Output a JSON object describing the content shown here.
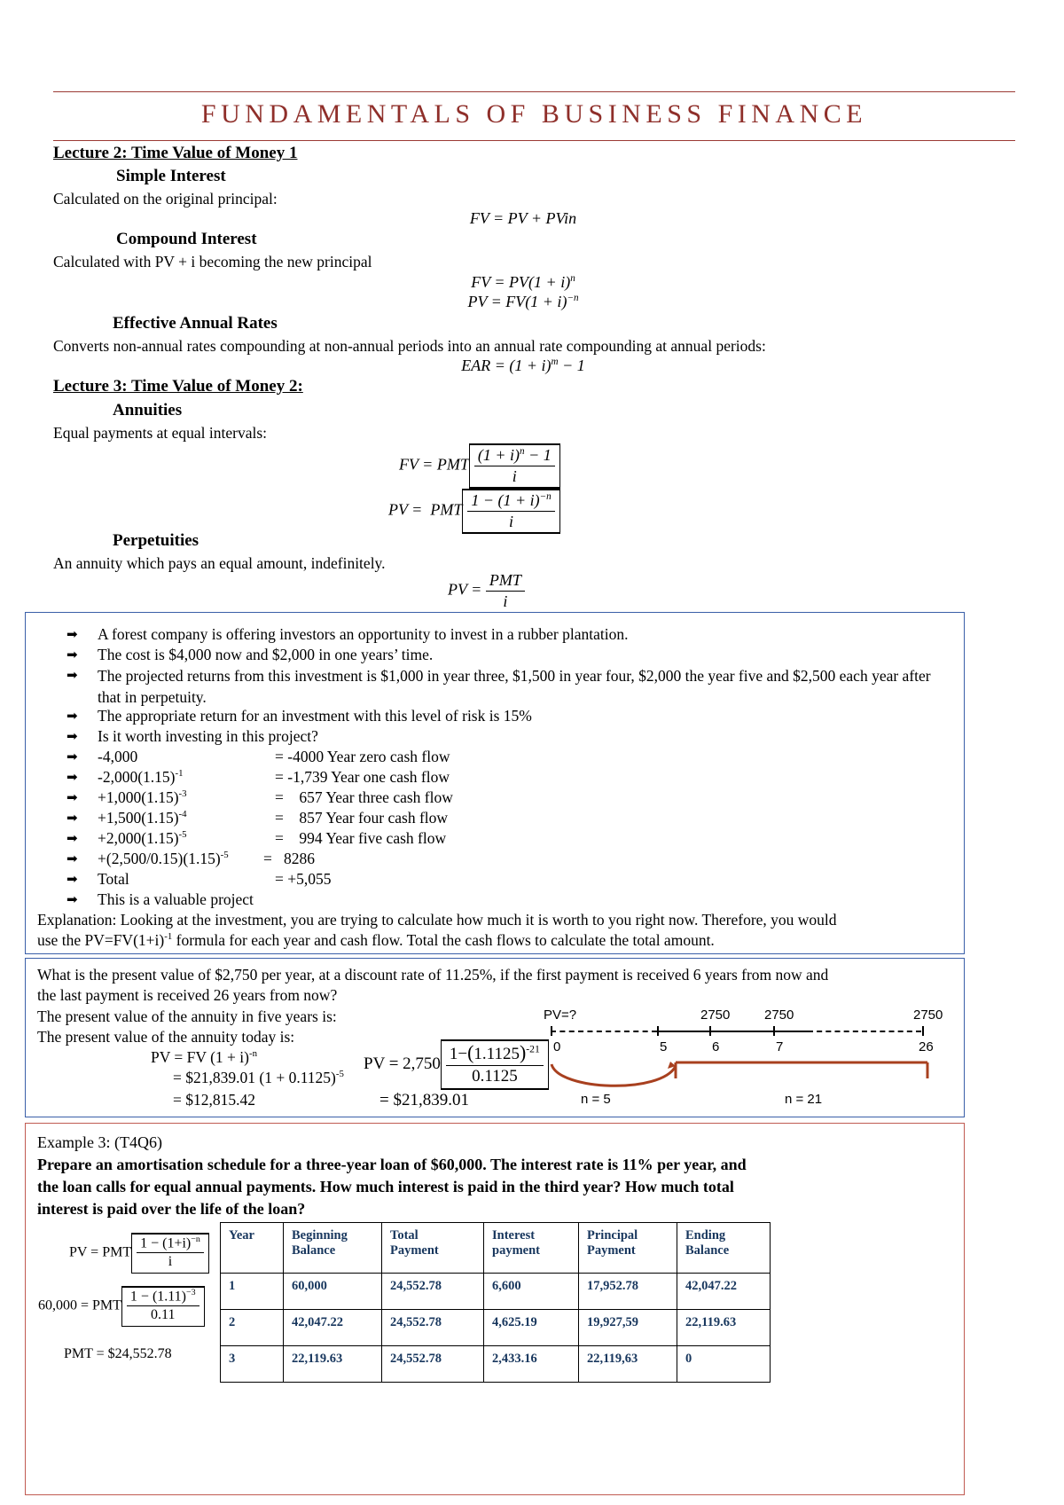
{
  "document": {
    "title": "FUNDAMENTALS OF BUSINESS FINANCE",
    "title_color": "#8f2f2a"
  },
  "lecture2": {
    "heading": "Lecture 2: Time Value of Money 1",
    "simple_interest": {
      "heading": "Simple Interest",
      "description": "Calculated on the original principal:",
      "formula": "FV = PV + PVin"
    },
    "compound_interest": {
      "heading": "Compound Interest",
      "description": "Calculated with PV + i becoming the new principal",
      "formula_fv": "FV = PV(1 + i)n",
      "formula_pv": "PV = FV(1 + i)-n"
    },
    "effective_annual_rates": {
      "heading": "Effective Annual Rates",
      "description": "Converts non-annual rates compounding at non-annual periods into an annual rate compounding at annual periods:",
      "formula": "EAR = (1 + i)m - 1"
    }
  },
  "lecture3": {
    "heading": "Lecture 3: Time Value of Money 2:",
    "annuities": {
      "heading": "Annuities",
      "description": "Equal payments at equal intervals:",
      "formula_fv_label": "FV = PMT",
      "formula_fv_num": "(1 + i)n - 1",
      "formula_fv_den": "i",
      "formula_pv_label": "PV =  PMT",
      "formula_pv_num": "1 - (1 + i)-n",
      "formula_pv_den": "i"
    },
    "perpetuities": {
      "heading": "Perpetuities",
      "description": "An annuity which pays an equal amount, indefinitely.",
      "formula_label": "PV =",
      "formula_num": "PMT",
      "formula_den": "i"
    }
  },
  "example1": {
    "border_color": "#3a5fa8",
    "bullets": [
      "A forest company is offering investors an opportunity to invest in a rubber plantation.",
      "The cost is $4,000 now and $2,000 in one years’ time.",
      "The projected returns from this investment is $1,000 in year three, $1,500 in year four, $2,000 the year five and $2,500 each year after that in perpetuity.",
      "The appropriate return for an investment with this level of risk is 15%",
      "Is it worth investing in this project?"
    ],
    "calc_rows": [
      {
        "expr": "-4,000",
        "exp": "",
        "result": "= -4000 Year zero cash flow"
      },
      {
        "expr": "-2,000(1.15)",
        "exp": "-1",
        "result": "= -1,739 Year one cash flow"
      },
      {
        "expr": "+1,000(1.15)",
        "exp": "-3",
        "result": "=    657 Year three cash flow"
      },
      {
        "expr": "+1,500(1.15)",
        "exp": "-4",
        "result": "=    857 Year four cash flow"
      },
      {
        "expr": "+2,000(1.15)",
        "exp": "-5",
        "result": "=    994 Year five cash flow"
      }
    ],
    "perp_row": {
      "expr": "+(2,500/0.15)(1.15)",
      "exp": "-5",
      "result": "=   8286"
    },
    "total_row": {
      "expr": "Total",
      "result": "= +5,055"
    },
    "conclusion": "This is a valuable project",
    "explanation_line1": "Explanation: Looking at the investment, you are trying to calculate how much it is worth to you right now. Therefore, you would",
    "explanation_line2_pre": "use the PV=FV(1+i)",
    "explanation_line2_sup": "-1",
    "explanation_line2_post": " formula for each year and cash flow. Total the cash flows to calculate the total amount."
  },
  "example2": {
    "border_color": "#3a5fa8",
    "question_line1": "What is the present value of $2,750 per year, at a discount rate of 11.25%, if the first payment is received 6 years from now and",
    "question_line2": "the last payment is received 26 years from now?",
    "line3": "The present value of the annuity in five years is:",
    "line4": "The present value of the annuity today is:",
    "work_line1": "PV = FV (1 + i)",
    "work_line1_sup": "-n",
    "work_line2": "= $21,839.01 (1 + 0.1125)",
    "work_line2_sup": "-5",
    "work_line3": "= $12,815.42",
    "pv_formula_label": "PV = 2,750",
    "pv_formula_num": "1 - (1.1125)",
    "pv_formula_num_sup": "-21",
    "pv_formula_den": "0.1125",
    "pv_formula_result": "= $21,839.01",
    "timeline": {
      "pv_label": "PV=?",
      "payment_labels": [
        "2750",
        "2750",
        "2750"
      ],
      "period_labels": [
        "0",
        "5",
        "6",
        "7",
        "26"
      ],
      "brace_left_label": "n = 5",
      "brace_right_label": "n = 21",
      "accent_color": "#a8401f"
    }
  },
  "example3": {
    "border_color": "#c05b52",
    "label": "Example 3: (T4Q6)",
    "prompt_line1": "Prepare an amortisation schedule for a three-year loan of $60,000. The interest rate is 11% per year, and",
    "prompt_line2": "the loan calls for equal annual payments. How much interest is paid in the third year? How much total",
    "prompt_line3": "interest is paid over the life of the loan?",
    "formulas": {
      "f1_label": "PV = PMT",
      "f1_num": "1 - (1+i)-n",
      "f1_den": "i",
      "f2_label": "60,000 = PMT",
      "f2_num": "1 - (1.11)-3",
      "f2_den": "0.11",
      "f3": "PMT = $24,552.78"
    },
    "table": {
      "headers": [
        {
          "l1": "Year",
          "l2": ""
        },
        {
          "l1": "Beginning",
          "l2": "Balance"
        },
        {
          "l1": "Total",
          "l2": "Payment"
        },
        {
          "l1": "Interest",
          "l2": "payment"
        },
        {
          "l1": "Principal",
          "l2": "Payment"
        },
        {
          "l1": "Ending",
          "l2": "Balance"
        }
      ],
      "rows": [
        [
          "1",
          "60,000",
          "24,552.78",
          "6,600",
          "17,952.78",
          "42,047.22"
        ],
        [
          "2",
          "42,047.22",
          "24,552.78",
          "4,625.19",
          "19,927,59",
          "22,119.63"
        ],
        [
          "3",
          "22,119.63",
          "24,552.78",
          "2,433.16",
          "22,119,63",
          "0"
        ]
      ],
      "header_color": "#17365d"
    }
  }
}
